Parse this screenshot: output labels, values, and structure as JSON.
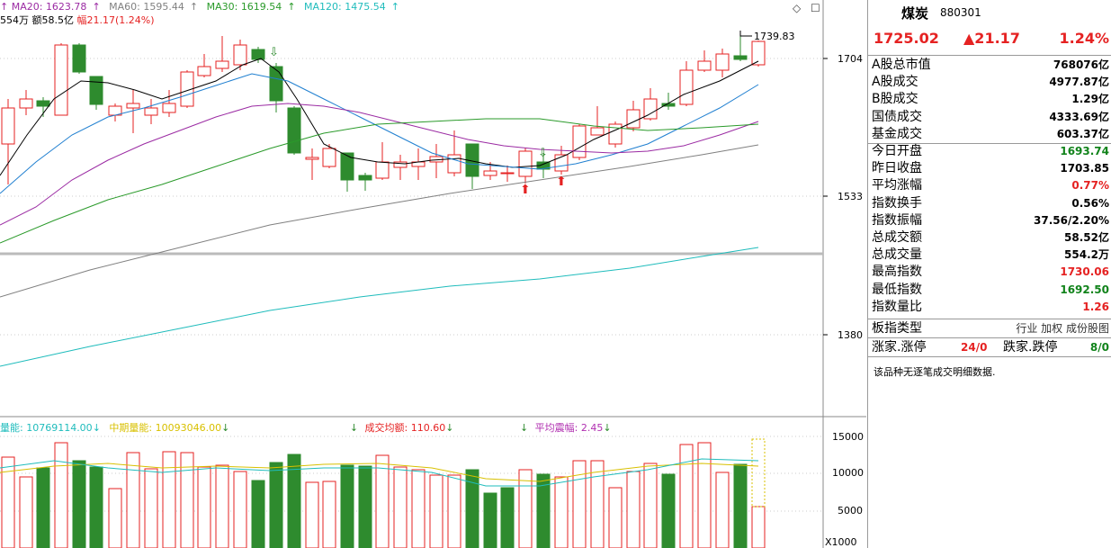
{
  "ma_legend": [
    {
      "label": "MA20",
      "value": "1623.78",
      "color": "#9b2ba3"
    },
    {
      "label": "MA60",
      "value": "1595.44",
      "color": "#808080"
    },
    {
      "label": "MA30",
      "value": "1619.54",
      "color": "#2a9a2a"
    },
    {
      "label": "MA120",
      "value": "1475.54",
      "color": "#1fbcbc"
    }
  ],
  "sub_legend": {
    "prefix": "554万",
    "amount_label": "额58.5亿",
    "range_label": "幅21.17(1.24%)"
  },
  "price_axis": {
    "ticks": [
      "1704",
      "1533",
      "1380"
    ],
    "peak_label": "1739.83"
  },
  "vol_legend": [
    {
      "text": "量能: 10769114.00",
      "color": "#1fbcbc"
    },
    {
      "text": "中期量能: 10093046.00",
      "color": "#d8c000"
    },
    {
      "text": "成交均额: 110.60",
      "color": "#e52222"
    },
    {
      "text": "平均震幅: 2.45",
      "color": "#b02fb0"
    }
  ],
  "vol_axis": {
    "ticks": [
      "15000",
      "10000",
      "5000"
    ],
    "unit": "X1000"
  },
  "colors": {
    "up": "#e52222",
    "down": "#2e8b2e",
    "ma5": "#000000",
    "ma10": "#1f7fd0",
    "ma20": "#9b2ba3",
    "ma30": "#2a9a2a",
    "ma60": "#808080",
    "ma120": "#1fbcbc"
  },
  "panel": {
    "title": "煤炭",
    "code": "880301",
    "price": "1725.02",
    "change": "▲21.17",
    "pct": "1.24%",
    "rows": [
      {
        "k": "A股总市值",
        "v": "768076亿",
        "c": "blk"
      },
      {
        "k": "A股成交",
        "v": "4977.87亿",
        "c": "blk"
      },
      {
        "k": "B股成交",
        "v": "1.29亿",
        "c": "blk"
      },
      {
        "k": "国债成交",
        "v": "4333.69亿",
        "c": "blk"
      },
      {
        "k": "基金成交",
        "v": "603.37亿",
        "c": "blk"
      },
      {
        "k": "今日开盘",
        "v": "1693.74",
        "c": "green"
      },
      {
        "k": "昨日收盘",
        "v": "1703.85",
        "c": "blk"
      },
      {
        "k": "平均涨幅",
        "v": "0.77%",
        "c": "red"
      },
      {
        "k": "指数换手",
        "v": "0.56%",
        "c": "blk"
      },
      {
        "k": "指数振幅",
        "v": "37.56/2.20%",
        "c": "blk"
      },
      {
        "k": "总成交额",
        "v": "58.52亿",
        "c": "blk"
      },
      {
        "k": "总成交量",
        "v": "554.2万",
        "c": "blk"
      },
      {
        "k": "最高指数",
        "v": "1730.06",
        "c": "red"
      },
      {
        "k": "最低指数",
        "v": "1692.50",
        "c": "green"
      },
      {
        "k": "指数量比",
        "v": "1.26",
        "c": "red"
      }
    ],
    "type_label": "板指类型",
    "type_values": "行业 加权 成份股图",
    "updown_label1": "涨家.涨停",
    "updown_val1": "24/0",
    "updown_label2": "跌家.跌停",
    "updown_val2": "8/0",
    "note": "该品种无逐笔成交明细数据."
  }
}
